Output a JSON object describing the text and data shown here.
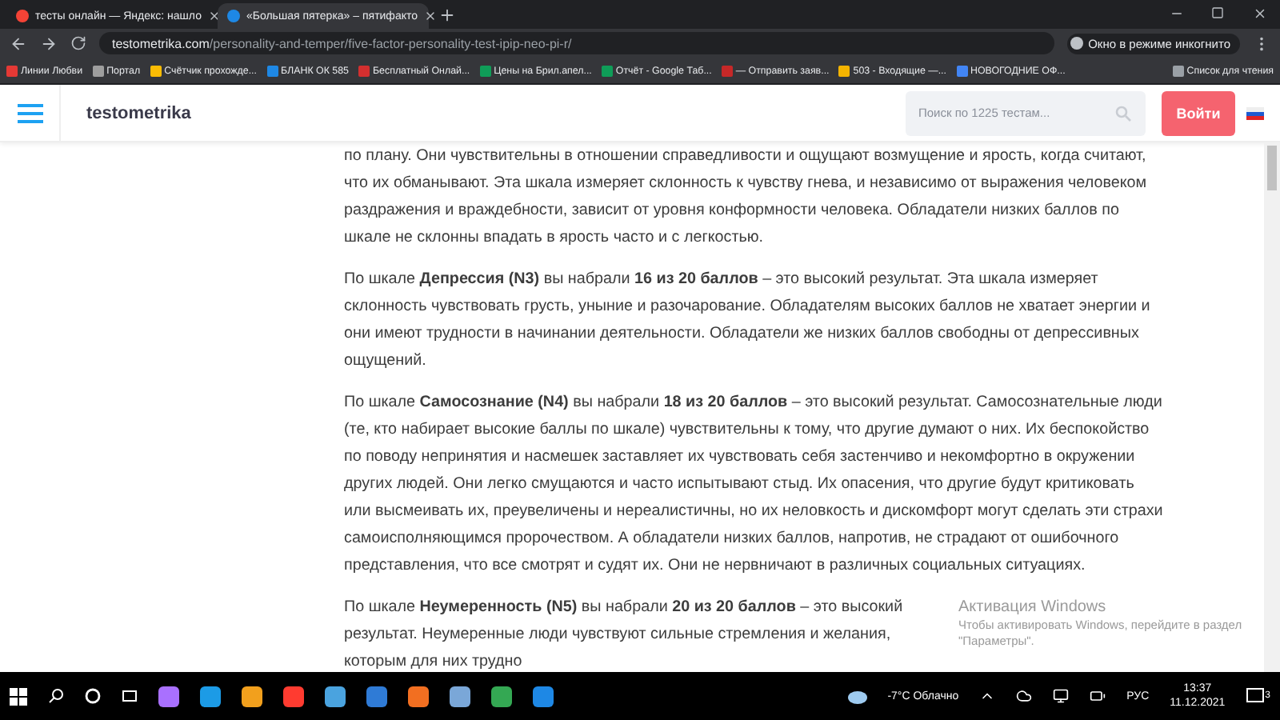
{
  "browser": {
    "tabs": [
      {
        "title": "тесты онлайн — Яндекс: нашло",
        "selected": false
      },
      {
        "title": "«Большая пятерка» – пятифакто",
        "selected": true
      }
    ],
    "url_host": "testometrika.com",
    "url_path": "/personality-and-temper/five-factor-personality-test-ipip-neo-pi-r/",
    "profile": "Окно в режиме инкогнито",
    "bookmarks": [
      "Линии Любви",
      "Портал",
      "Счётчик прохожде...",
      "БЛАНК ОК 585",
      "Бесплатный Онлай...",
      "Цены на Брил.апел...",
      "Отчёт - Google Таб...",
      "— Отправить заяв...",
      "503 - Входящие —...",
      "НОВОГОДНИЕ ОФ..."
    ],
    "reading_list": "Список для чтения"
  },
  "site": {
    "logo": "testometrika",
    "search": {
      "placeholder": "Поиск по 1225 тестам..."
    },
    "login": "Войти"
  },
  "paragraphs": [
    "по плану. Они чувствительны в отношении справедливости и ощущают возмущение и ярость, когда считают, что их обманывают. Эта шкала измеряет склонность к чувству гнева, и независимо от выражения человеком раздражения и враждебности, зависит от уровня конформности человека. Обладатели низких баллов по шкале не склонны впадать в ярость часто и с легкостью.",
    "По шкале **Депрессия (N3)** вы набрали **16 из 20 баллов** – это высокий результат. Эта шкала измеряет склонность чувствовать грусть, уныние и разочарование. Обладателям высоких баллов не хватает энергии и они имеют трудности в начинании деятельности. Обладатели же низких баллов свободны от депрессивных ощущений.",
    "По шкале **Самосознание (N4)** вы набрали **18 из 20 баллов** – это высокий результат. Самосознательные люди (те, кто набирает высокие баллы по шкале) чувствительны к тому, что другие думают о них. Их беспокойство по поводу непринятия и насмешек заставляет их чувствовать себя застенчиво и некомфортно в окружении других людей. Они легко смущаются и часто испытывают стыд. Их опасения, что другие будут критиковать или высмеивать их, преувеличены и нереалистичны, но их неловкость и дискомфорт могут сделать эти страхи самоисполняющимся пророчеством. А обладатели низких баллов, напротив, не страдают от ошибочного представления, что все смотрят и судят их. Они не нервничают в различных социальных ситуациях.",
    "По шкале **Неумеренность (N5)** вы набрали **20 из 20 баллов** – это высокий результат. Неумеренные люди чувствуют сильные стремления и желания, которым для них трудно"
  ],
  "activation": {
    "title": "Активация Windows",
    "text": "Чтобы активировать Windows, перейдите в раздел \"Параметры\"."
  },
  "taskbar": {
    "weather": "-7°C  Облачно",
    "language": "РУС",
    "time": "13:37",
    "date": "11.12.2021",
    "notifications": "3"
  }
}
